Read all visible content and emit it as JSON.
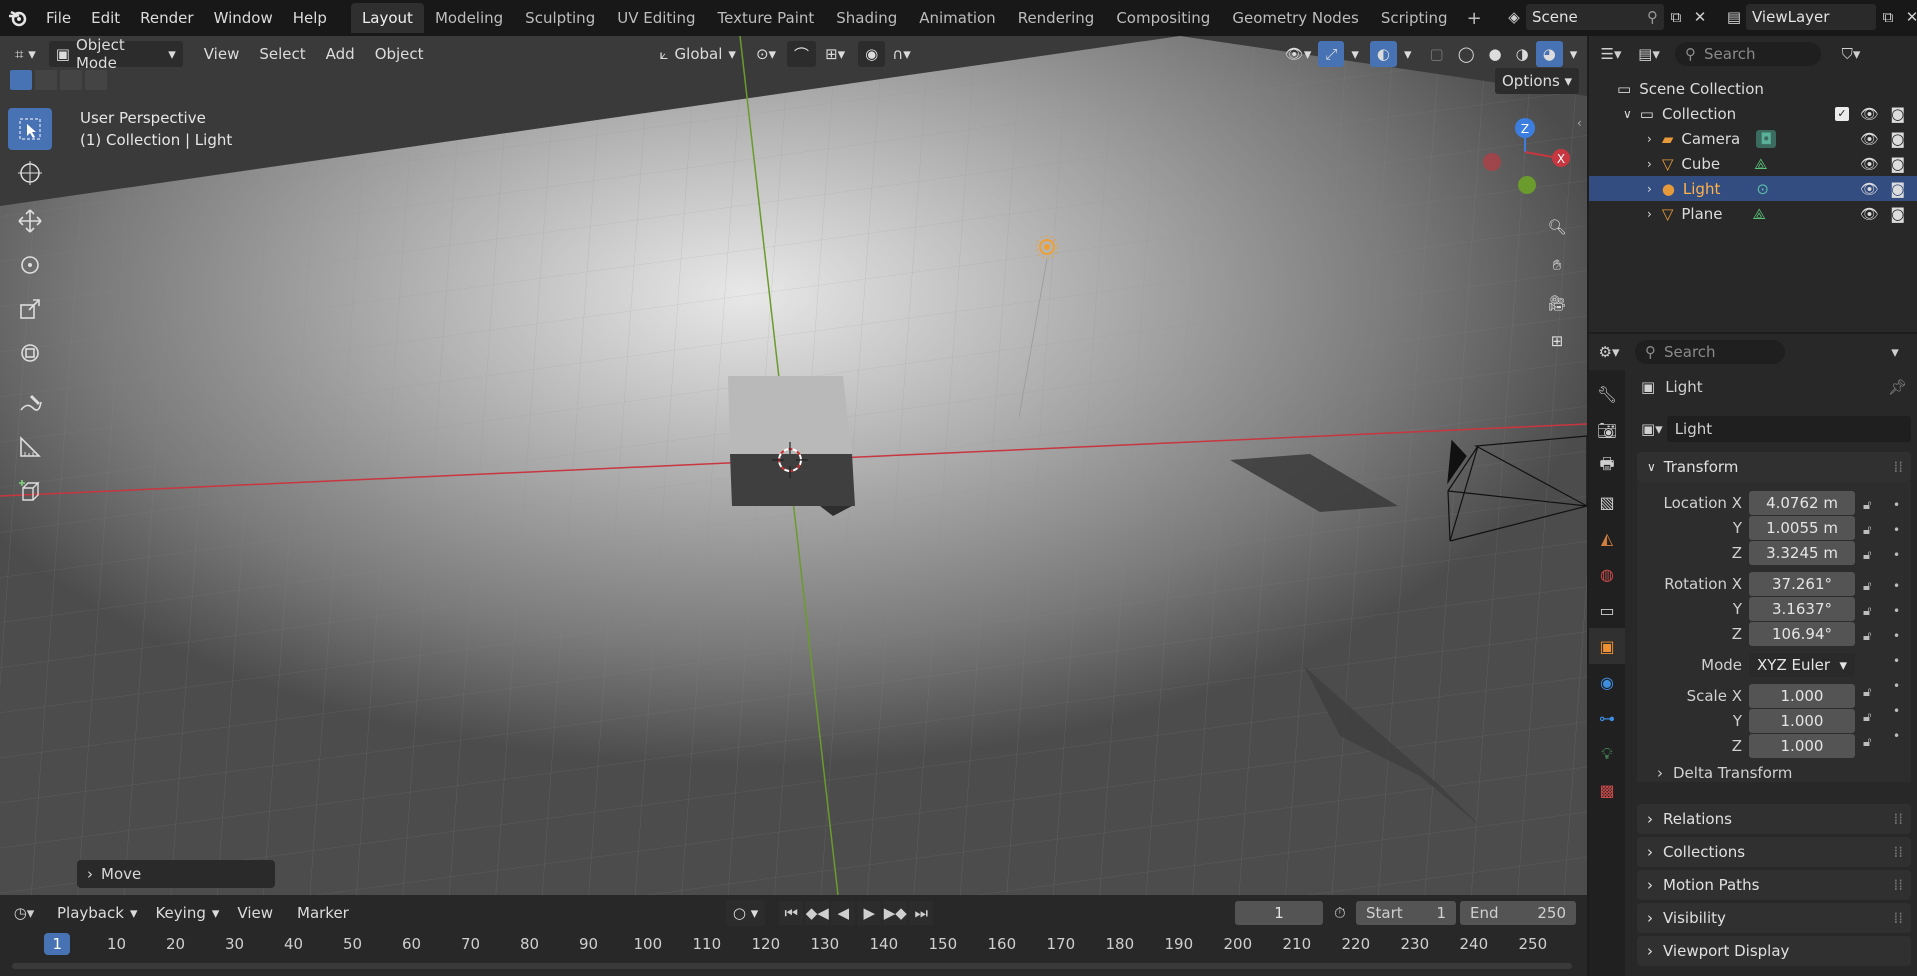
{
  "topbar": {
    "menus": [
      "File",
      "Edit",
      "Render",
      "Window",
      "Help"
    ],
    "workspaces": [
      "Layout",
      "Modeling",
      "Sculpting",
      "UV Editing",
      "Texture Paint",
      "Shading",
      "Animation",
      "Rendering",
      "Compositing",
      "Geometry Nodes",
      "Scripting"
    ],
    "active_workspace": "Layout",
    "add_tab": "+",
    "scene_name": "Scene",
    "viewlayer_name": "ViewLayer"
  },
  "viewport_header": {
    "mode": "Object Mode",
    "menus": [
      "View",
      "Select",
      "Add",
      "Object"
    ],
    "orientation": "Global",
    "options_label": "Options"
  },
  "viewport": {
    "perspective_label": "User Perspective",
    "context_label": "(1) Collection | Light",
    "last_operator": "Move",
    "gizmo_axes": {
      "z": "Z",
      "x": "X"
    }
  },
  "outliner": {
    "search_placeholder": "Search",
    "root": "Scene Collection",
    "collection": "Collection",
    "items": [
      {
        "name": "Camera",
        "selected": false
      },
      {
        "name": "Cube",
        "selected": false
      },
      {
        "name": "Light",
        "selected": true
      },
      {
        "name": "Plane",
        "selected": false
      }
    ]
  },
  "properties": {
    "search_placeholder": "Search",
    "object_title": "Light",
    "object_name_field": "Light",
    "transform_label": "Transform",
    "location_label": "Location X",
    "rotation_label": "Rotation X",
    "scale_label": "Scale X",
    "axis_y": "Y",
    "axis_z": "Z",
    "location": [
      "4.0762 m",
      "1.0055 m",
      "3.3245 m"
    ],
    "rotation": [
      "37.261°",
      "3.1637°",
      "106.94°"
    ],
    "mode_label": "Mode",
    "mode_value": "XYZ Euler",
    "scale": [
      "1.000",
      "1.000",
      "1.000"
    ],
    "delta_label": "Delta Transform",
    "panels": [
      "Relations",
      "Collections",
      "Motion Paths",
      "Visibility",
      "Viewport Display"
    ]
  },
  "timeline": {
    "menus": [
      "Playback",
      "Keying",
      "View",
      "Marker"
    ],
    "current_frame": "1",
    "start_label": "Start",
    "start_value": "1",
    "end_label": "End",
    "end_value": "250",
    "ruler": [
      "1",
      "10",
      "20",
      "30",
      "40",
      "50",
      "60",
      "70",
      "80",
      "90",
      "100",
      "110",
      "120",
      "130",
      "140",
      "150",
      "160",
      "170",
      "180",
      "190",
      "200",
      "210",
      "220",
      "230",
      "240",
      "250"
    ]
  },
  "colors": {
    "accent": "#4772b3",
    "selected_row": "#334d80",
    "x_axis": "#c8363f",
    "y_axis": "#6a9b2c",
    "z_axis": "#3b7ee0",
    "light_orange": "#f0a030"
  }
}
